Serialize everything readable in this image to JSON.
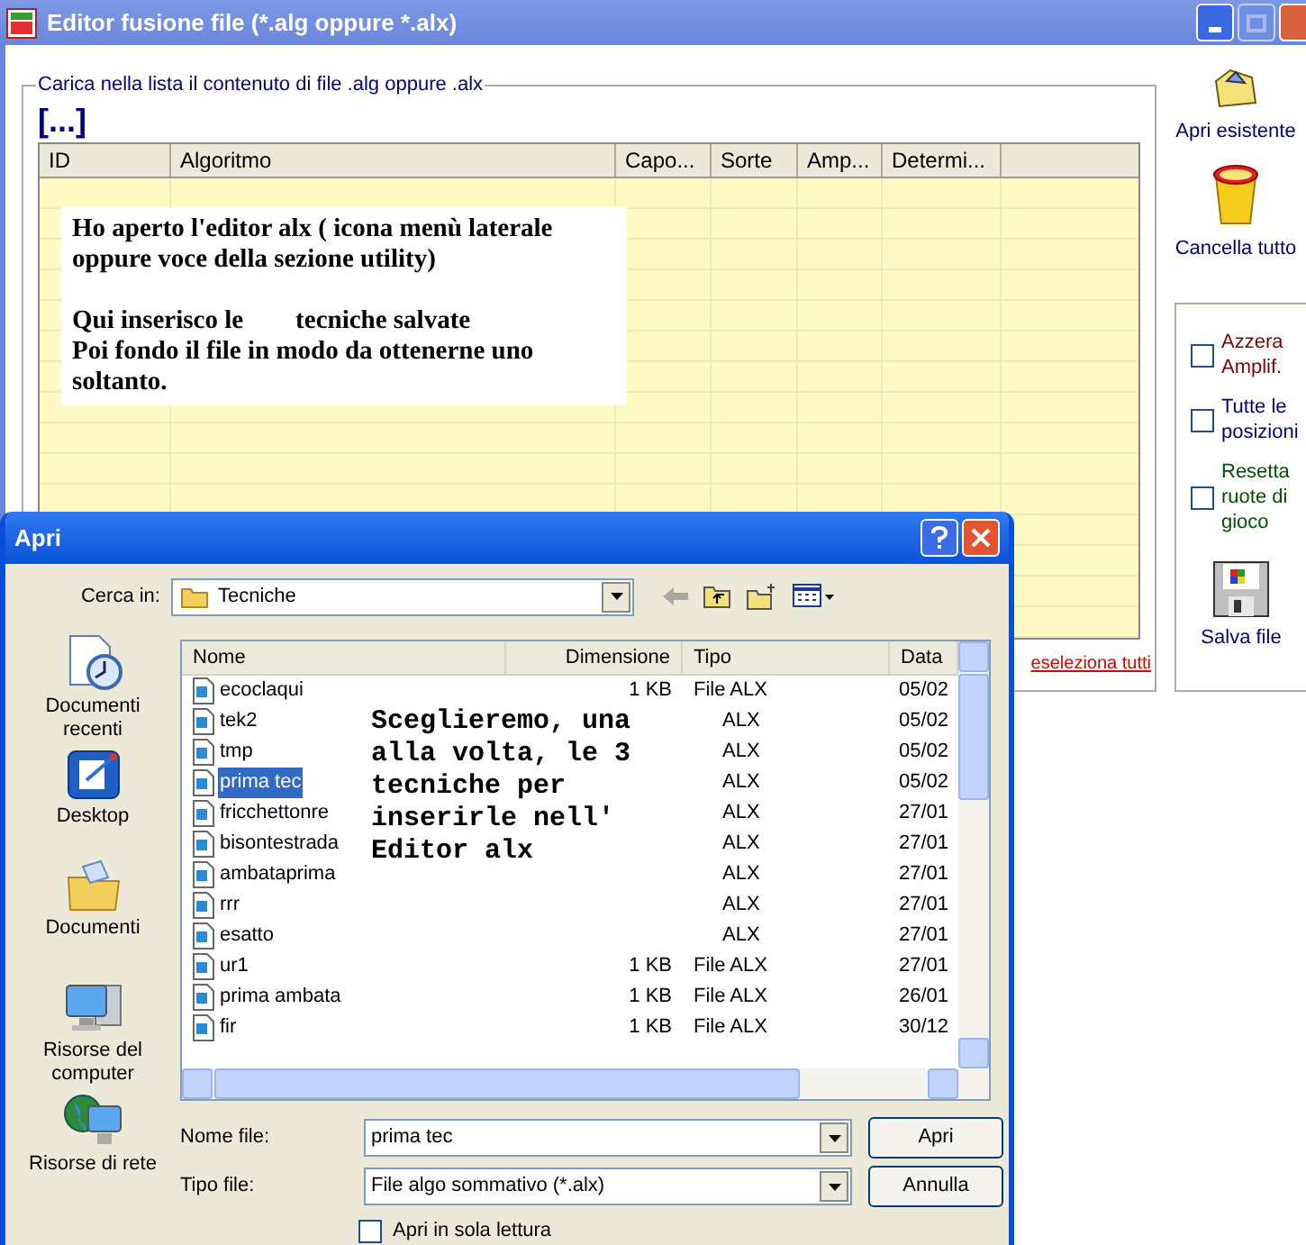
{
  "main_window": {
    "title": "Editor fusione file (*.alg oppure *.alx)",
    "group_title": "Carica nella lista il contenuto di file .alg oppure .alx",
    "path_label": "[...]",
    "grid": {
      "columns": [
        "ID",
        "Algoritmo",
        "Capo...",
        "Sorte",
        "Amp...",
        "Determi..."
      ]
    },
    "note": [
      "Ho aperto l'editor alx ( icona menù laterale oppure voce della sezione utility)",
      "Qui inserisco le        tecniche salvate",
      "Poi fondo il file in modo da ottenerne uno soltanto."
    ],
    "deselect_link": "eseleziona tutti",
    "side_buttons": [
      {
        "label": "Apri esistente",
        "kind": "open"
      },
      {
        "label": "Cancella tutto",
        "kind": "trash"
      }
    ],
    "options": [
      {
        "label": "Azzera Amplif.",
        "checked": false,
        "color": "#800000"
      },
      {
        "label": "Tutte le posizioni",
        "checked": false,
        "color": "#000080"
      },
      {
        "label": "Resetta ruote di gioco",
        "checked": false,
        "color": "#005000"
      }
    ],
    "save_button": "Salva file"
  },
  "dialog": {
    "title": "Apri",
    "look_in_label": "Cerca in:",
    "look_in_value": "Tecniche",
    "places": [
      {
        "label": "Documenti recenti",
        "kind": "recent"
      },
      {
        "label": "Desktop",
        "kind": "desktop"
      },
      {
        "label": "Documenti",
        "kind": "documents"
      },
      {
        "label": "Risorse del computer",
        "kind": "computer"
      },
      {
        "label": "Risorse di rete",
        "kind": "network"
      }
    ],
    "columns": [
      "Nome",
      "Dimensione",
      "Tipo",
      "Data"
    ],
    "files": [
      {
        "name": "ecoclaqui",
        "size": "1 KB",
        "type": "File ALX",
        "date": "05/02",
        "selected": false
      },
      {
        "name": "tek2",
        "type": "ALX",
        "date": "05/02",
        "selected": false
      },
      {
        "name": "tmp",
        "type": "ALX",
        "date": "05/02",
        "selected": false
      },
      {
        "name": "prima tec",
        "type": "ALX",
        "date": "05/02",
        "selected": true
      },
      {
        "name": "fricchettonre",
        "type": "ALX",
        "date": "27/01",
        "selected": false
      },
      {
        "name": "bisontestrada",
        "type": "ALX",
        "date": "27/01",
        "selected": false
      },
      {
        "name": "ambataprima",
        "type": "ALX",
        "date": "27/01",
        "selected": false
      },
      {
        "name": "rrr",
        "type": "ALX",
        "date": "27/01",
        "selected": false
      },
      {
        "name": "esatto",
        "type": "ALX",
        "date": "27/01",
        "selected": false
      },
      {
        "name": "ur1",
        "size": "1 KB",
        "type": "File ALX",
        "date": "27/01",
        "selected": false
      },
      {
        "name": "prima ambata",
        "size": "1 KB",
        "type": "File ALX",
        "date": "26/01",
        "selected": false
      },
      {
        "name": "fir",
        "size": "1 KB",
        "type": "File ALX",
        "date": "30/12",
        "selected": false
      }
    ],
    "overlay_note": "Sceglieremo, una alla volta, le 3 tecniche per inserirle nell' Editor alx",
    "file_name_label": "Nome file:",
    "file_name": "prima tec",
    "file_type_label": "Tipo file:",
    "file_type": "File algo sommativo (*.alx)",
    "read_only": {
      "label": "Apri in sola lettura",
      "checked": false
    },
    "buttons": [
      "Apri",
      "Annulla"
    ]
  }
}
